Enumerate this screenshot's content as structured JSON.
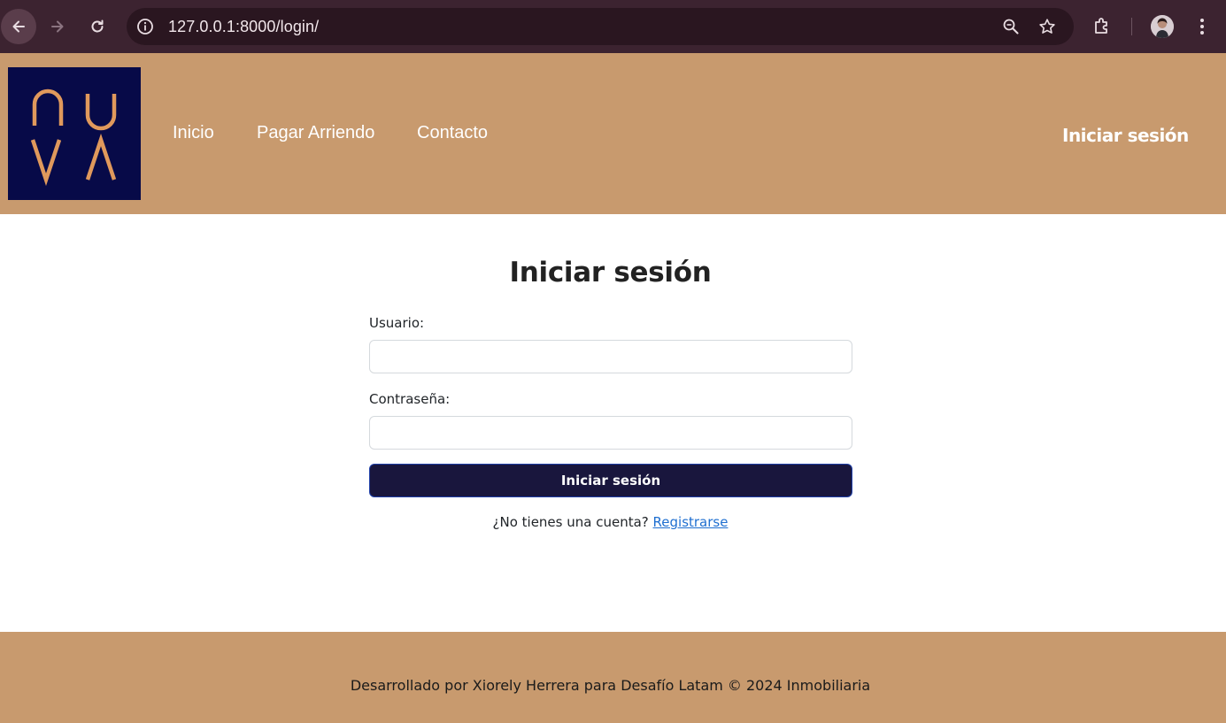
{
  "browser": {
    "url": "127.0.0.1:8000/login/",
    "icons": [
      "back-icon",
      "forward-icon",
      "reload-icon",
      "info-icon",
      "zoom-icon",
      "star-icon",
      "extensions-icon",
      "profile-avatar",
      "menu-icon"
    ]
  },
  "header": {
    "logo_text": "NUVA",
    "nav": {
      "inicio": "Inicio",
      "pagar": "Pagar Arriendo",
      "contacto": "Contacto"
    },
    "login_link": "Iniciar sesión"
  },
  "form": {
    "title": "Iniciar sesión",
    "user_label": "Usuario:",
    "user_value": "",
    "pass_label": "Contraseña:",
    "pass_value": "",
    "submit_label": "Iniciar sesión",
    "register_prompt": "¿No tienes una cuenta?",
    "register_link": "Registrarse"
  },
  "footer": {
    "text": "Desarrollado por Xiorely Herrera para Desafío Latam © 2024 Inmobiliaria"
  },
  "colors": {
    "header_bg": "#c89a6e",
    "logo_bg": "#070a48",
    "logo_fg": "#e0995c",
    "button_bg": "#19163d",
    "link": "#1f6fd0"
  }
}
